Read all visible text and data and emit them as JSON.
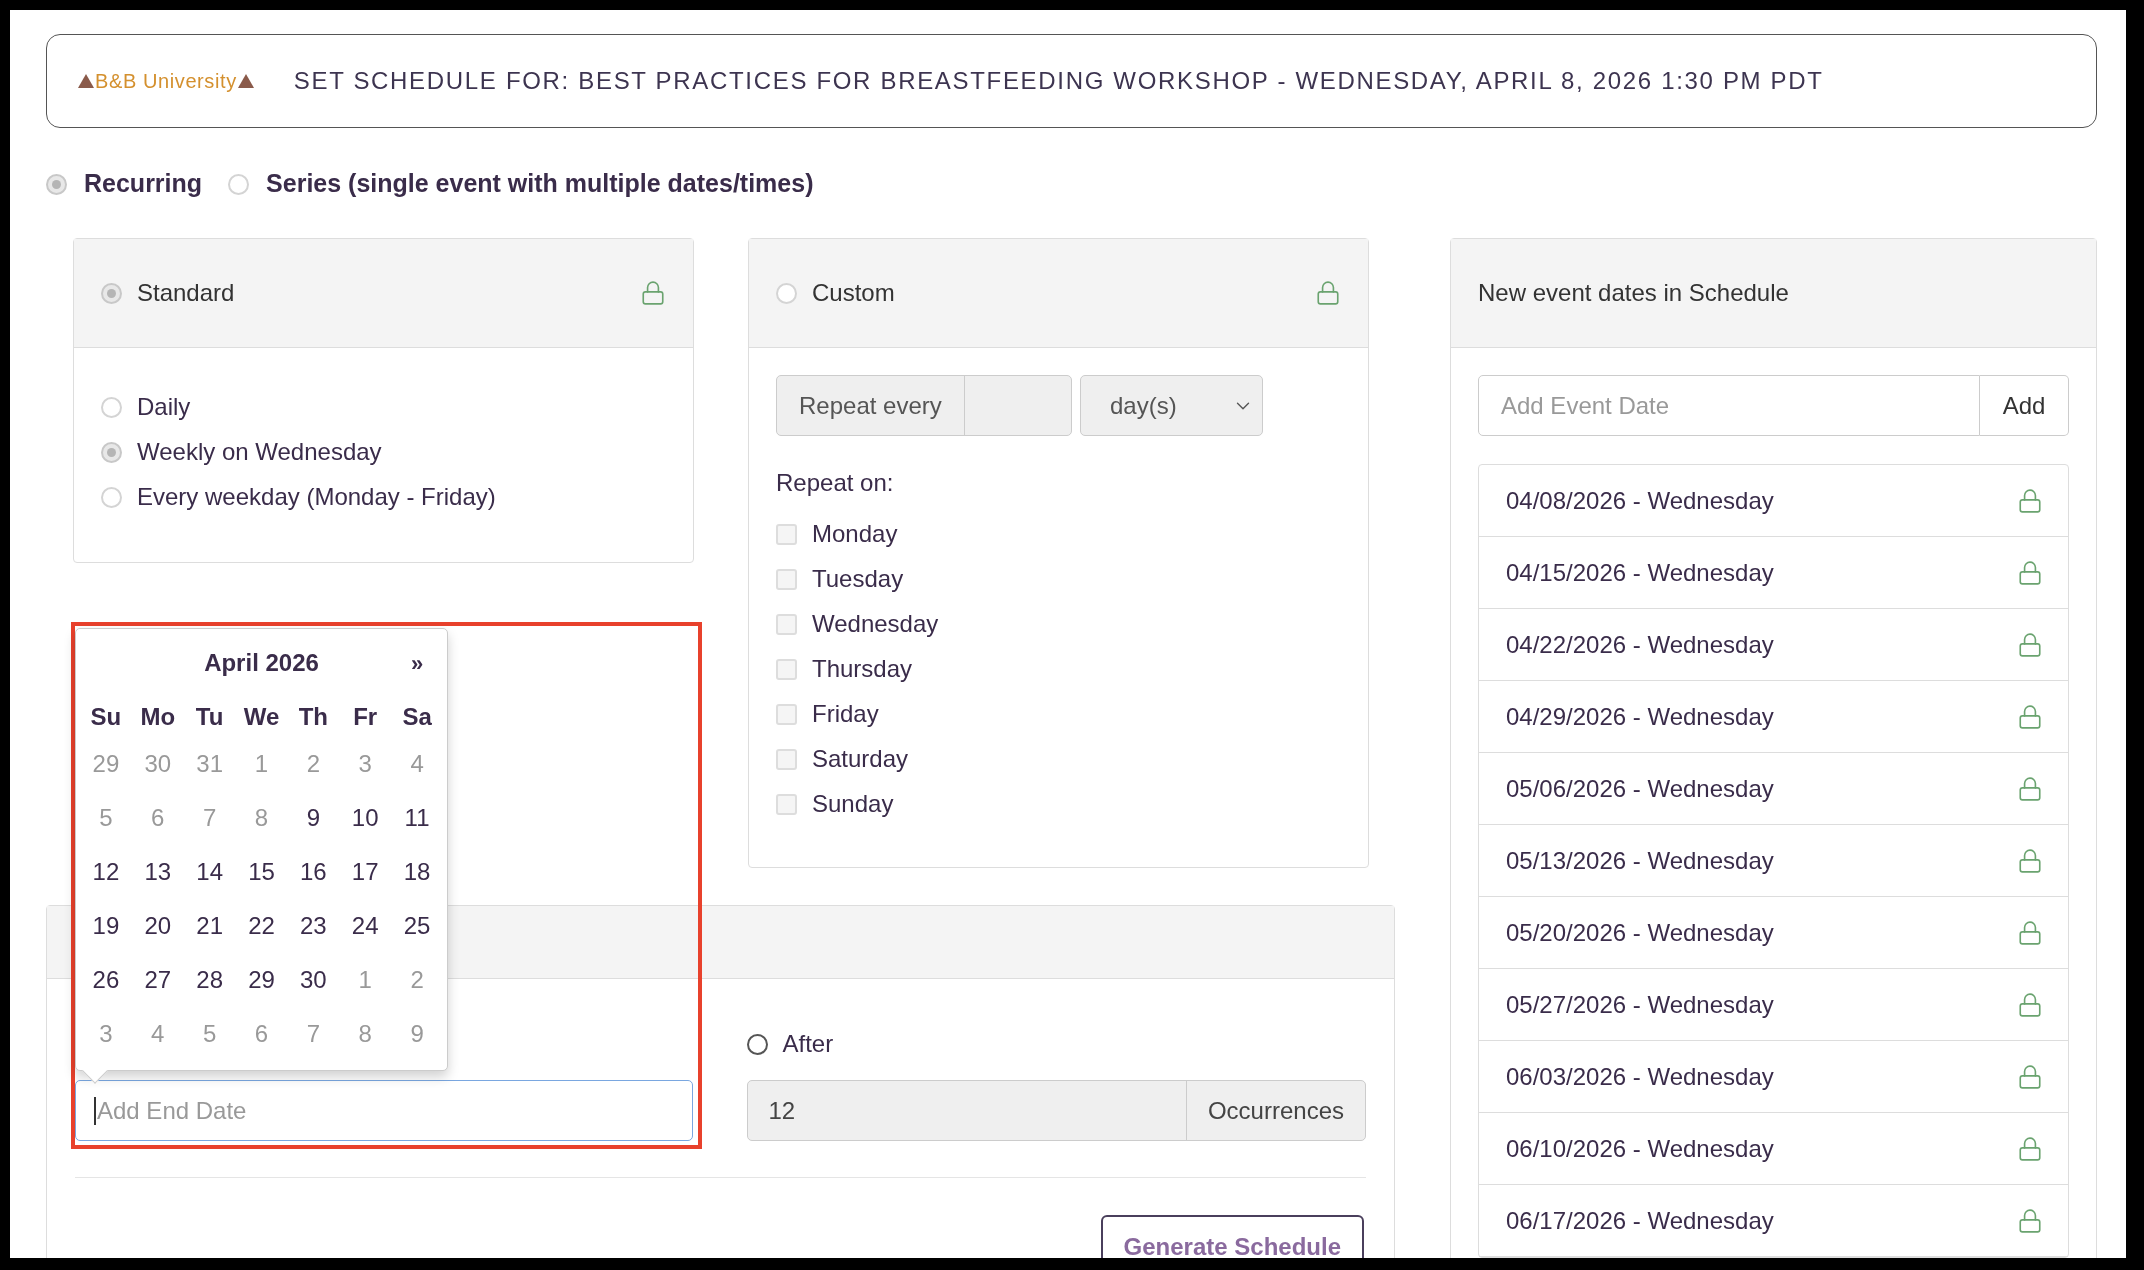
{
  "header": {
    "logo": "B&B University",
    "title": "SET SCHEDULE FOR: BEST PRACTICES FOR BREASTFEEDING WORKSHOP - WEDNESDAY, APRIL 8, 2026 1:30 PM PDT"
  },
  "schedule_types": [
    {
      "label": "Recurring",
      "selected": true
    },
    {
      "label": "Series (single event with multiple dates/times)",
      "selected": false
    }
  ],
  "standard": {
    "label": "Standard",
    "selected": true,
    "options": [
      {
        "label": "Daily",
        "selected": false
      },
      {
        "label": "Weekly on Wednesday",
        "selected": true
      },
      {
        "label": "Every weekday (Monday - Friday)",
        "selected": false
      }
    ]
  },
  "custom": {
    "label": "Custom",
    "selected": false,
    "repeat_every_label": "Repeat every",
    "unit": "day(s)",
    "repeat_on_label": "Repeat on:",
    "days": [
      {
        "label": "Monday",
        "checked": false
      },
      {
        "label": "Tuesday",
        "checked": false
      },
      {
        "label": "Wednesday",
        "checked": false
      },
      {
        "label": "Thursday",
        "checked": false
      },
      {
        "label": "Friday",
        "checked": false
      },
      {
        "label": "Saturday",
        "checked": false
      },
      {
        "label": "Sunday",
        "checked": false
      }
    ]
  },
  "end": {
    "end_date_placeholder": "Add End Date",
    "after": {
      "label": "After",
      "selected": false
    },
    "occurrences": "12",
    "occurrences_label": "Occurrences",
    "generate_button": "Generate Schedule"
  },
  "datepicker": {
    "month": "April 2026",
    "next": "»",
    "weekdays": [
      "Su",
      "Mo",
      "Tu",
      "We",
      "Th",
      "Fr",
      "Sa"
    ],
    "weeks": [
      [
        {
          "label": "29",
          "muted": true
        },
        {
          "label": "30",
          "muted": true
        },
        {
          "label": "31",
          "muted": true
        },
        {
          "label": "1",
          "muted": true
        },
        {
          "label": "2",
          "muted": true
        },
        {
          "label": "3",
          "muted": true
        },
        {
          "label": "4",
          "muted": true
        }
      ],
      [
        {
          "label": "5",
          "muted": true
        },
        {
          "label": "6",
          "muted": true
        },
        {
          "label": "7",
          "muted": true
        },
        {
          "label": "8",
          "muted": true
        },
        {
          "label": "9",
          "muted": false
        },
        {
          "label": "10",
          "muted": false
        },
        {
          "label": "11",
          "muted": false
        }
      ],
      [
        {
          "label": "12",
          "muted": false
        },
        {
          "label": "13",
          "muted": false
        },
        {
          "label": "14",
          "muted": false
        },
        {
          "label": "15",
          "muted": false
        },
        {
          "label": "16",
          "muted": false
        },
        {
          "label": "17",
          "muted": false
        },
        {
          "label": "18",
          "muted": false
        }
      ],
      [
        {
          "label": "19",
          "muted": false
        },
        {
          "label": "20",
          "muted": false
        },
        {
          "label": "21",
          "muted": false
        },
        {
          "label": "22",
          "muted": false
        },
        {
          "label": "23",
          "muted": false
        },
        {
          "label": "24",
          "muted": false
        },
        {
          "label": "25",
          "muted": false
        }
      ],
      [
        {
          "label": "26",
          "muted": false
        },
        {
          "label": "27",
          "muted": false
        },
        {
          "label": "28",
          "muted": false
        },
        {
          "label": "29",
          "muted": false
        },
        {
          "label": "30",
          "muted": false
        },
        {
          "label": "1",
          "muted": true
        },
        {
          "label": "2",
          "muted": true
        }
      ],
      [
        {
          "label": "3",
          "muted": true
        },
        {
          "label": "4",
          "muted": true
        },
        {
          "label": "5",
          "muted": true
        },
        {
          "label": "6",
          "muted": true
        },
        {
          "label": "7",
          "muted": true
        },
        {
          "label": "8",
          "muted": true
        },
        {
          "label": "9",
          "muted": true
        }
      ]
    ]
  },
  "event_dates": {
    "title": "New event dates in Schedule",
    "placeholder": "Add Event Date",
    "add_button": "Add",
    "dates": [
      "04/08/2026 - Wednesday",
      "04/15/2026 - Wednesday",
      "04/22/2026 - Wednesday",
      "04/29/2026 - Wednesday",
      "05/06/2026 - Wednesday",
      "05/13/2026 - Wednesday",
      "05/20/2026 - Wednesday",
      "05/27/2026 - Wednesday",
      "06/03/2026 - Wednesday",
      "06/10/2026 - Wednesday",
      "06/17/2026 - Wednesday"
    ]
  }
}
